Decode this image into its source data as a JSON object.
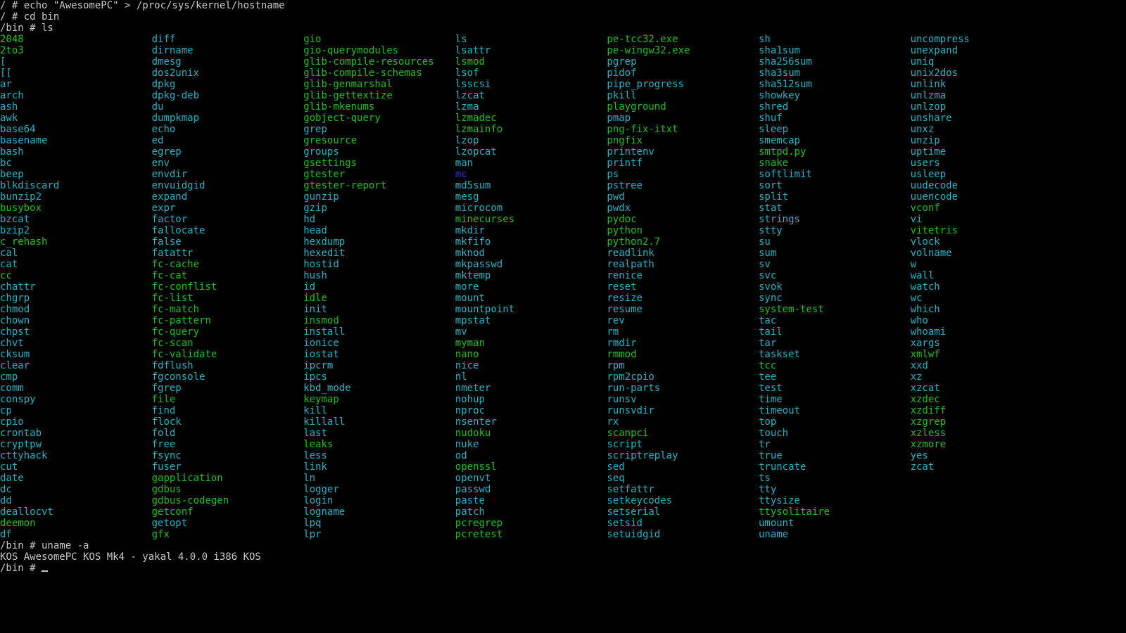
{
  "colors": {
    "background": "#000000",
    "text": "#c8c8c8",
    "cyan_entry": "#1bb5c8",
    "green_entry": "#19c219",
    "blue_entry": "#2a2adf"
  },
  "pre_lines": [
    "/ # echo \"AwesomePC\" > /proc/sys/kernel/hostname",
    "/ # cd bin",
    "/bin # ls"
  ],
  "listing": [
    {
      "name": "2048",
      "color": "green"
    },
    {
      "name": "2to3",
      "color": "green"
    },
    {
      "name": "[",
      "color": "cyan"
    },
    {
      "name": "[[",
      "color": "cyan"
    },
    {
      "name": "ar",
      "color": "cyan"
    },
    {
      "name": "arch",
      "color": "cyan"
    },
    {
      "name": "ash",
      "color": "cyan"
    },
    {
      "name": "awk",
      "color": "cyan"
    },
    {
      "name": "base64",
      "color": "cyan"
    },
    {
      "name": "basename",
      "color": "cyan"
    },
    {
      "name": "bash",
      "color": "cyan"
    },
    {
      "name": "bc",
      "color": "cyan"
    },
    {
      "name": "beep",
      "color": "cyan"
    },
    {
      "name": "blkdiscard",
      "color": "cyan"
    },
    {
      "name": "bunzip2",
      "color": "cyan"
    },
    {
      "name": "busybox",
      "color": "green"
    },
    {
      "name": "bzcat",
      "color": "cyan"
    },
    {
      "name": "bzip2",
      "color": "cyan"
    },
    {
      "name": "c_rehash",
      "color": "green"
    },
    {
      "name": "cal",
      "color": "cyan"
    },
    {
      "name": "cat",
      "color": "cyan"
    },
    {
      "name": "cc",
      "color": "green"
    },
    {
      "name": "chattr",
      "color": "cyan"
    },
    {
      "name": "chgrp",
      "color": "cyan"
    },
    {
      "name": "chmod",
      "color": "cyan"
    },
    {
      "name": "chown",
      "color": "cyan"
    },
    {
      "name": "chpst",
      "color": "cyan"
    },
    {
      "name": "chvt",
      "color": "cyan"
    },
    {
      "name": "cksum",
      "color": "cyan"
    },
    {
      "name": "clear",
      "color": "cyan"
    },
    {
      "name": "cmp",
      "color": "cyan"
    },
    {
      "name": "comm",
      "color": "cyan"
    },
    {
      "name": "conspy",
      "color": "cyan"
    },
    {
      "name": "cp",
      "color": "cyan"
    },
    {
      "name": "cpio",
      "color": "cyan"
    },
    {
      "name": "crontab",
      "color": "cyan"
    },
    {
      "name": "cryptpw",
      "color": "cyan"
    },
    {
      "name": "cttyhack",
      "color": "cyan"
    },
    {
      "name": "cut",
      "color": "cyan"
    },
    {
      "name": "date",
      "color": "cyan"
    },
    {
      "name": "dc",
      "color": "cyan"
    },
    {
      "name": "dd",
      "color": "cyan"
    },
    {
      "name": "deallocvt",
      "color": "cyan"
    },
    {
      "name": "deemon",
      "color": "green"
    },
    {
      "name": "df",
      "color": "cyan"
    },
    {
      "name": "diff",
      "color": "cyan"
    },
    {
      "name": "dirname",
      "color": "cyan"
    },
    {
      "name": "dmesg",
      "color": "cyan"
    },
    {
      "name": "dos2unix",
      "color": "cyan"
    },
    {
      "name": "dpkg",
      "color": "cyan"
    },
    {
      "name": "dpkg-deb",
      "color": "cyan"
    },
    {
      "name": "du",
      "color": "cyan"
    },
    {
      "name": "dumpkmap",
      "color": "cyan"
    },
    {
      "name": "echo",
      "color": "cyan"
    },
    {
      "name": "ed",
      "color": "cyan"
    },
    {
      "name": "egrep",
      "color": "cyan"
    },
    {
      "name": "env",
      "color": "cyan"
    },
    {
      "name": "envdir",
      "color": "cyan"
    },
    {
      "name": "envuidgid",
      "color": "cyan"
    },
    {
      "name": "expand",
      "color": "cyan"
    },
    {
      "name": "expr",
      "color": "cyan"
    },
    {
      "name": "factor",
      "color": "cyan"
    },
    {
      "name": "fallocate",
      "color": "cyan"
    },
    {
      "name": "false",
      "color": "cyan"
    },
    {
      "name": "fatattr",
      "color": "cyan"
    },
    {
      "name": "fc-cache",
      "color": "green"
    },
    {
      "name": "fc-cat",
      "color": "green"
    },
    {
      "name": "fc-conflist",
      "color": "green"
    },
    {
      "name": "fc-list",
      "color": "green"
    },
    {
      "name": "fc-match",
      "color": "green"
    },
    {
      "name": "fc-pattern",
      "color": "green"
    },
    {
      "name": "fc-query",
      "color": "green"
    },
    {
      "name": "fc-scan",
      "color": "green"
    },
    {
      "name": "fc-validate",
      "color": "green"
    },
    {
      "name": "fdflush",
      "color": "cyan"
    },
    {
      "name": "fgconsole",
      "color": "cyan"
    },
    {
      "name": "fgrep",
      "color": "cyan"
    },
    {
      "name": "file",
      "color": "green"
    },
    {
      "name": "find",
      "color": "cyan"
    },
    {
      "name": "flock",
      "color": "cyan"
    },
    {
      "name": "fold",
      "color": "cyan"
    },
    {
      "name": "free",
      "color": "cyan"
    },
    {
      "name": "fsync",
      "color": "cyan"
    },
    {
      "name": "fuser",
      "color": "cyan"
    },
    {
      "name": "gapplication",
      "color": "green"
    },
    {
      "name": "gdbus",
      "color": "green"
    },
    {
      "name": "gdbus-codegen",
      "color": "green"
    },
    {
      "name": "getconf",
      "color": "green"
    },
    {
      "name": "getopt",
      "color": "cyan"
    },
    {
      "name": "gfx",
      "color": "green"
    },
    {
      "name": "gio",
      "color": "green"
    },
    {
      "name": "gio-querymodules",
      "color": "green"
    },
    {
      "name": "glib-compile-resources",
      "color": "green"
    },
    {
      "name": "glib-compile-schemas",
      "color": "green"
    },
    {
      "name": "glib-genmarshal",
      "color": "green"
    },
    {
      "name": "glib-gettextize",
      "color": "green"
    },
    {
      "name": "glib-mkenums",
      "color": "green"
    },
    {
      "name": "gobject-query",
      "color": "green"
    },
    {
      "name": "grep",
      "color": "cyan"
    },
    {
      "name": "gresource",
      "color": "green"
    },
    {
      "name": "groups",
      "color": "cyan"
    },
    {
      "name": "gsettings",
      "color": "green"
    },
    {
      "name": "gtester",
      "color": "green"
    },
    {
      "name": "gtester-report",
      "color": "green"
    },
    {
      "name": "gunzip",
      "color": "cyan"
    },
    {
      "name": "gzip",
      "color": "cyan"
    },
    {
      "name": "hd",
      "color": "cyan"
    },
    {
      "name": "head",
      "color": "cyan"
    },
    {
      "name": "hexdump",
      "color": "cyan"
    },
    {
      "name": "hexedit",
      "color": "cyan"
    },
    {
      "name": "hostid",
      "color": "cyan"
    },
    {
      "name": "hush",
      "color": "cyan"
    },
    {
      "name": "id",
      "color": "cyan"
    },
    {
      "name": "idle",
      "color": "green"
    },
    {
      "name": "init",
      "color": "cyan"
    },
    {
      "name": "insmod",
      "color": "green"
    },
    {
      "name": "install",
      "color": "cyan"
    },
    {
      "name": "ionice",
      "color": "cyan"
    },
    {
      "name": "iostat",
      "color": "cyan"
    },
    {
      "name": "ipcrm",
      "color": "cyan"
    },
    {
      "name": "ipcs",
      "color": "cyan"
    },
    {
      "name": "kbd_mode",
      "color": "cyan"
    },
    {
      "name": "keymap",
      "color": "green"
    },
    {
      "name": "kill",
      "color": "cyan"
    },
    {
      "name": "killall",
      "color": "cyan"
    },
    {
      "name": "last",
      "color": "cyan"
    },
    {
      "name": "leaks",
      "color": "green"
    },
    {
      "name": "less",
      "color": "cyan"
    },
    {
      "name": "link",
      "color": "cyan"
    },
    {
      "name": "ln",
      "color": "cyan"
    },
    {
      "name": "logger",
      "color": "cyan"
    },
    {
      "name": "login",
      "color": "cyan"
    },
    {
      "name": "logname",
      "color": "cyan"
    },
    {
      "name": "lpq",
      "color": "cyan"
    },
    {
      "name": "lpr",
      "color": "cyan"
    },
    {
      "name": "ls",
      "color": "cyan"
    },
    {
      "name": "lsattr",
      "color": "cyan"
    },
    {
      "name": "lsmod",
      "color": "green"
    },
    {
      "name": "lsof",
      "color": "cyan"
    },
    {
      "name": "lsscsi",
      "color": "cyan"
    },
    {
      "name": "lzcat",
      "color": "cyan"
    },
    {
      "name": "lzma",
      "color": "cyan"
    },
    {
      "name": "lzmadec",
      "color": "green"
    },
    {
      "name": "lzmainfo",
      "color": "green"
    },
    {
      "name": "lzop",
      "color": "cyan"
    },
    {
      "name": "lzopcat",
      "color": "cyan"
    },
    {
      "name": "man",
      "color": "cyan"
    },
    {
      "name": "mc",
      "color": "blue"
    },
    {
      "name": "md5sum",
      "color": "cyan"
    },
    {
      "name": "mesg",
      "color": "cyan"
    },
    {
      "name": "microcom",
      "color": "cyan"
    },
    {
      "name": "minecurses",
      "color": "green"
    },
    {
      "name": "mkdir",
      "color": "cyan"
    },
    {
      "name": "mkfifo",
      "color": "cyan"
    },
    {
      "name": "mknod",
      "color": "cyan"
    },
    {
      "name": "mkpasswd",
      "color": "cyan"
    },
    {
      "name": "mktemp",
      "color": "cyan"
    },
    {
      "name": "more",
      "color": "cyan"
    },
    {
      "name": "mount",
      "color": "cyan"
    },
    {
      "name": "mountpoint",
      "color": "cyan"
    },
    {
      "name": "mpstat",
      "color": "cyan"
    },
    {
      "name": "mv",
      "color": "cyan"
    },
    {
      "name": "myman",
      "color": "green"
    },
    {
      "name": "nano",
      "color": "green"
    },
    {
      "name": "nice",
      "color": "cyan"
    },
    {
      "name": "nl",
      "color": "cyan"
    },
    {
      "name": "nmeter",
      "color": "cyan"
    },
    {
      "name": "nohup",
      "color": "cyan"
    },
    {
      "name": "nproc",
      "color": "cyan"
    },
    {
      "name": "nsenter",
      "color": "cyan"
    },
    {
      "name": "nudoku",
      "color": "green"
    },
    {
      "name": "nuke",
      "color": "cyan"
    },
    {
      "name": "od",
      "color": "cyan"
    },
    {
      "name": "openssl",
      "color": "green"
    },
    {
      "name": "openvt",
      "color": "cyan"
    },
    {
      "name": "passwd",
      "color": "cyan"
    },
    {
      "name": "paste",
      "color": "cyan"
    },
    {
      "name": "patch",
      "color": "cyan"
    },
    {
      "name": "pcregrep",
      "color": "green"
    },
    {
      "name": "pcretest",
      "color": "green"
    },
    {
      "name": "pe-tcc32.exe",
      "color": "green"
    },
    {
      "name": "pe-wingw32.exe",
      "color": "green"
    },
    {
      "name": "pgrep",
      "color": "cyan"
    },
    {
      "name": "pidof",
      "color": "cyan"
    },
    {
      "name": "pipe_progress",
      "color": "cyan"
    },
    {
      "name": "pkill",
      "color": "cyan"
    },
    {
      "name": "playground",
      "color": "green"
    },
    {
      "name": "pmap",
      "color": "cyan"
    },
    {
      "name": "png-fix-itxt",
      "color": "green"
    },
    {
      "name": "pngfix",
      "color": "green"
    },
    {
      "name": "printenv",
      "color": "cyan"
    },
    {
      "name": "printf",
      "color": "cyan"
    },
    {
      "name": "ps",
      "color": "cyan"
    },
    {
      "name": "pstree",
      "color": "cyan"
    },
    {
      "name": "pwd",
      "color": "cyan"
    },
    {
      "name": "pwdx",
      "color": "cyan"
    },
    {
      "name": "pydoc",
      "color": "green"
    },
    {
      "name": "python",
      "color": "green"
    },
    {
      "name": "python2.7",
      "color": "green"
    },
    {
      "name": "readlink",
      "color": "cyan"
    },
    {
      "name": "realpath",
      "color": "cyan"
    },
    {
      "name": "renice",
      "color": "cyan"
    },
    {
      "name": "reset",
      "color": "cyan"
    },
    {
      "name": "resize",
      "color": "cyan"
    },
    {
      "name": "resume",
      "color": "cyan"
    },
    {
      "name": "rev",
      "color": "cyan"
    },
    {
      "name": "rm",
      "color": "cyan"
    },
    {
      "name": "rmdir",
      "color": "cyan"
    },
    {
      "name": "rmmod",
      "color": "green"
    },
    {
      "name": "rpm",
      "color": "cyan"
    },
    {
      "name": "rpm2cpio",
      "color": "cyan"
    },
    {
      "name": "run-parts",
      "color": "cyan"
    },
    {
      "name": "runsv",
      "color": "cyan"
    },
    {
      "name": "runsvdir",
      "color": "cyan"
    },
    {
      "name": "rx",
      "color": "cyan"
    },
    {
      "name": "scanpci",
      "color": "green"
    },
    {
      "name": "script",
      "color": "cyan"
    },
    {
      "name": "scriptreplay",
      "color": "cyan"
    },
    {
      "name": "sed",
      "color": "cyan"
    },
    {
      "name": "seq",
      "color": "cyan"
    },
    {
      "name": "setfattr",
      "color": "cyan"
    },
    {
      "name": "setkeycodes",
      "color": "cyan"
    },
    {
      "name": "setserial",
      "color": "cyan"
    },
    {
      "name": "setsid",
      "color": "cyan"
    },
    {
      "name": "setuidgid",
      "color": "cyan"
    },
    {
      "name": "sh",
      "color": "cyan"
    },
    {
      "name": "sha1sum",
      "color": "cyan"
    },
    {
      "name": "sha256sum",
      "color": "cyan"
    },
    {
      "name": "sha3sum",
      "color": "cyan"
    },
    {
      "name": "sha512sum",
      "color": "cyan"
    },
    {
      "name": "showkey",
      "color": "cyan"
    },
    {
      "name": "shred",
      "color": "cyan"
    },
    {
      "name": "shuf",
      "color": "cyan"
    },
    {
      "name": "sleep",
      "color": "cyan"
    },
    {
      "name": "smemcap",
      "color": "cyan"
    },
    {
      "name": "smtpd.py",
      "color": "green"
    },
    {
      "name": "snake",
      "color": "green"
    },
    {
      "name": "softlimit",
      "color": "cyan"
    },
    {
      "name": "sort",
      "color": "cyan"
    },
    {
      "name": "split",
      "color": "cyan"
    },
    {
      "name": "stat",
      "color": "cyan"
    },
    {
      "name": "strings",
      "color": "cyan"
    },
    {
      "name": "stty",
      "color": "cyan"
    },
    {
      "name": "su",
      "color": "cyan"
    },
    {
      "name": "sum",
      "color": "cyan"
    },
    {
      "name": "sv",
      "color": "cyan"
    },
    {
      "name": "svc",
      "color": "cyan"
    },
    {
      "name": "svok",
      "color": "cyan"
    },
    {
      "name": "sync",
      "color": "cyan"
    },
    {
      "name": "system-test",
      "color": "green"
    },
    {
      "name": "tac",
      "color": "cyan"
    },
    {
      "name": "tail",
      "color": "cyan"
    },
    {
      "name": "tar",
      "color": "cyan"
    },
    {
      "name": "taskset",
      "color": "cyan"
    },
    {
      "name": "tcc",
      "color": "green"
    },
    {
      "name": "tee",
      "color": "cyan"
    },
    {
      "name": "test",
      "color": "cyan"
    },
    {
      "name": "time",
      "color": "cyan"
    },
    {
      "name": "timeout",
      "color": "cyan"
    },
    {
      "name": "top",
      "color": "cyan"
    },
    {
      "name": "touch",
      "color": "cyan"
    },
    {
      "name": "tr",
      "color": "cyan"
    },
    {
      "name": "true",
      "color": "cyan"
    },
    {
      "name": "truncate",
      "color": "cyan"
    },
    {
      "name": "ts",
      "color": "cyan"
    },
    {
      "name": "tty",
      "color": "cyan"
    },
    {
      "name": "ttysize",
      "color": "cyan"
    },
    {
      "name": "ttysolitaire",
      "color": "green"
    },
    {
      "name": "umount",
      "color": "cyan"
    },
    {
      "name": "uname",
      "color": "cyan"
    },
    {
      "name": "uncompress",
      "color": "cyan"
    },
    {
      "name": "unexpand",
      "color": "cyan"
    },
    {
      "name": "uniq",
      "color": "cyan"
    },
    {
      "name": "unix2dos",
      "color": "cyan"
    },
    {
      "name": "unlink",
      "color": "cyan"
    },
    {
      "name": "unlzma",
      "color": "cyan"
    },
    {
      "name": "unlzop",
      "color": "cyan"
    },
    {
      "name": "unshare",
      "color": "cyan"
    },
    {
      "name": "unxz",
      "color": "cyan"
    },
    {
      "name": "unzip",
      "color": "cyan"
    },
    {
      "name": "uptime",
      "color": "cyan"
    },
    {
      "name": "users",
      "color": "cyan"
    },
    {
      "name": "usleep",
      "color": "cyan"
    },
    {
      "name": "uudecode",
      "color": "cyan"
    },
    {
      "name": "uuencode",
      "color": "cyan"
    },
    {
      "name": "vconf",
      "color": "green"
    },
    {
      "name": "vi",
      "color": "cyan"
    },
    {
      "name": "vitetris",
      "color": "green"
    },
    {
      "name": "vlock",
      "color": "cyan"
    },
    {
      "name": "volname",
      "color": "cyan"
    },
    {
      "name": "w",
      "color": "cyan"
    },
    {
      "name": "wall",
      "color": "cyan"
    },
    {
      "name": "watch",
      "color": "cyan"
    },
    {
      "name": "wc",
      "color": "cyan"
    },
    {
      "name": "which",
      "color": "cyan"
    },
    {
      "name": "who",
      "color": "cyan"
    },
    {
      "name": "whoami",
      "color": "cyan"
    },
    {
      "name": "xargs",
      "color": "cyan"
    },
    {
      "name": "xmlwf",
      "color": "green"
    },
    {
      "name": "xxd",
      "color": "cyan"
    },
    {
      "name": "xz",
      "color": "cyan"
    },
    {
      "name": "xzcat",
      "color": "cyan"
    },
    {
      "name": "xzdec",
      "color": "green"
    },
    {
      "name": "xzdiff",
      "color": "green"
    },
    {
      "name": "xzgrep",
      "color": "green"
    },
    {
      "name": "xzless",
      "color": "green"
    },
    {
      "name": "xzmore",
      "color": "green"
    },
    {
      "name": "yes",
      "color": "cyan"
    },
    {
      "name": "zcat",
      "color": "cyan"
    }
  ],
  "post_lines": [
    "/bin # uname -a",
    "KOS AwesomePC KOS Mk4 - yakal 4.0.0 i386 KOS"
  ],
  "prompt": "/bin # "
}
